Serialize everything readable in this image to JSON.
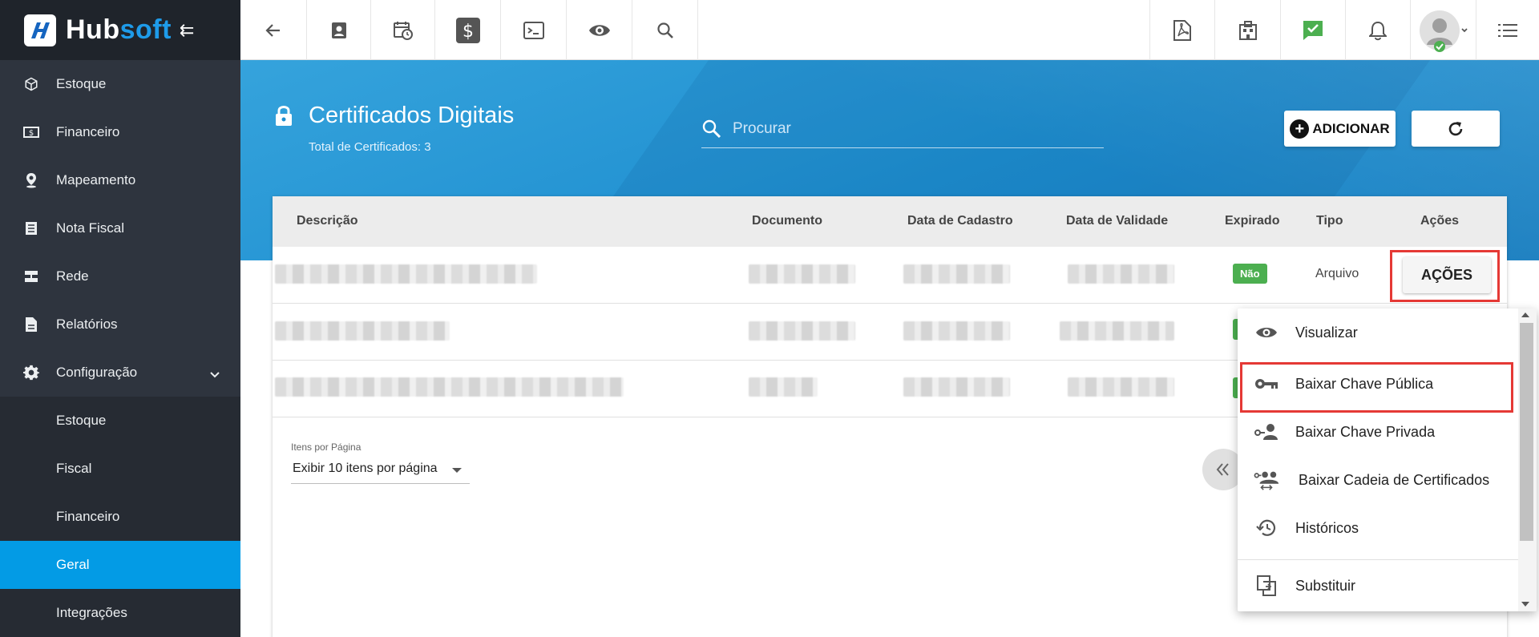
{
  "brand": {
    "name_part1": "Hub",
    "name_part2": "soft"
  },
  "sidebar": {
    "items": [
      {
        "label": "Estoque",
        "icon": "cube-icon"
      },
      {
        "label": "Financeiro",
        "icon": "money-icon"
      },
      {
        "label": "Mapeamento",
        "icon": "map-pin-icon"
      },
      {
        "label": "Nota Fiscal",
        "icon": "document-list-icon"
      },
      {
        "label": "Rede",
        "icon": "server-icon"
      },
      {
        "label": "Relatórios",
        "icon": "report-icon"
      },
      {
        "label": "Configuração",
        "icon": "gear-icon"
      }
    ],
    "subitems": [
      {
        "label": "Estoque"
      },
      {
        "label": "Fiscal"
      },
      {
        "label": "Financeiro"
      },
      {
        "label": "Geral",
        "active": true
      },
      {
        "label": "Integrações"
      }
    ]
  },
  "header": {
    "title": "Certificados Digitais",
    "subtitle": "Total de Certificados: 3",
    "search_placeholder": "Procurar",
    "add_label": "ADICIONAR"
  },
  "table": {
    "columns": [
      "Descrição",
      "Documento",
      "Data de Cadastro",
      "Data de Validade",
      "Expirado",
      "Tipo",
      "Ações"
    ],
    "row1": {
      "expirado": "Não",
      "tipo": "Arquivo",
      "acoes": "AÇÕES"
    }
  },
  "pagination": {
    "label": "Itens por Página",
    "selected": "Exibir 10 itens por página"
  },
  "dropdown": {
    "items": [
      {
        "label": "Visualizar",
        "icon": "eye-icon"
      },
      {
        "label": "Baixar Chave Pública",
        "icon": "key-icon"
      },
      {
        "label": "Baixar Chave Privada",
        "icon": "user-key-icon"
      },
      {
        "label": "Baixar Cadeia de Certificados",
        "icon": "group-key-icon"
      },
      {
        "label": "Históricos",
        "icon": "history-icon"
      },
      {
        "label": "Substituir",
        "icon": "replace-icon"
      }
    ]
  },
  "colors": {
    "sidebar_bg": "#2e343e",
    "active": "#039be5",
    "header_blue": "#1f8fd0",
    "badge_green": "#4caf50",
    "highlight_red": "#e53935"
  }
}
